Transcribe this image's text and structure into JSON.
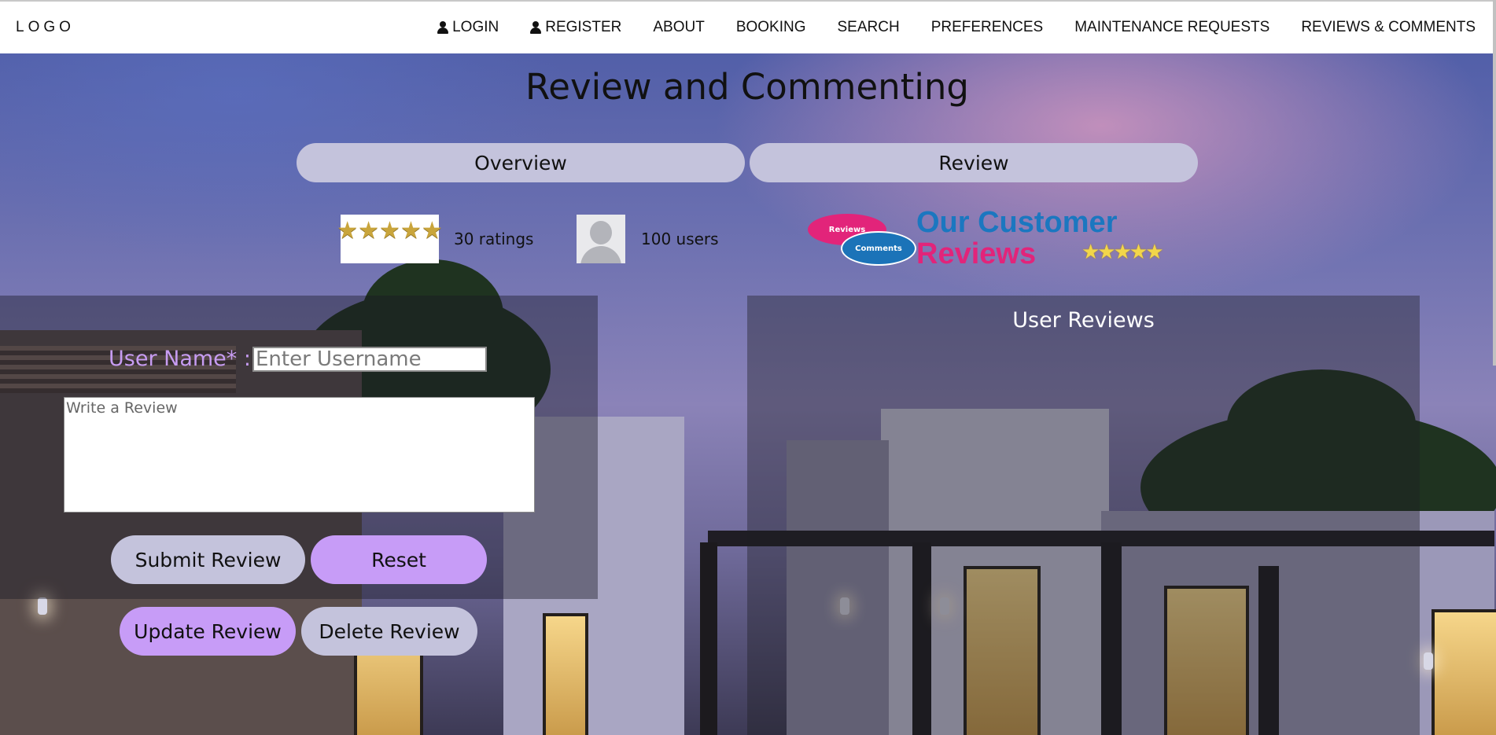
{
  "nav": {
    "logo": "LOGO",
    "items": [
      {
        "label": "LOGIN",
        "icon": "user-icon"
      },
      {
        "label": "REGISTER",
        "icon": "user-icon"
      },
      {
        "label": "ABOUT"
      },
      {
        "label": "BOOKING"
      },
      {
        "label": "SEARCH"
      },
      {
        "label": "PREFERENCES"
      },
      {
        "label": "MAINTENANCE REQUESTS"
      },
      {
        "label": "REVIEWS & COMMENTS"
      }
    ]
  },
  "page": {
    "title": "Review and Commenting",
    "tabs": [
      {
        "label": "Overview"
      },
      {
        "label": "Review"
      }
    ]
  },
  "stats": {
    "ratings_text": "30 ratings",
    "users_text": "100 users",
    "stars_glyphs": "★★★★★"
  },
  "customer_reviews_logo": {
    "bubble_1": "Reviews",
    "bubble_2": "Comments",
    "line_1": "Our Customer",
    "line_2": "Reviews",
    "stars_glyphs": "★★★★★"
  },
  "form": {
    "username_label": "User Name* :",
    "username_placeholder": "Enter Username",
    "username_value": "",
    "review_placeholder": "Write a Review",
    "review_value": "",
    "submit_label": "Submit Review",
    "reset_label": "Reset",
    "update_label": "Update Review",
    "delete_label": "Delete Review"
  },
  "reviews_panel": {
    "title": "User Reviews"
  },
  "colors": {
    "tab_grey": "#c4c3dc",
    "button_purple": "#c79cf7",
    "label_purple": "#c79cf2",
    "brand_blue": "#1b77c0",
    "brand_pink": "#e2247a"
  }
}
